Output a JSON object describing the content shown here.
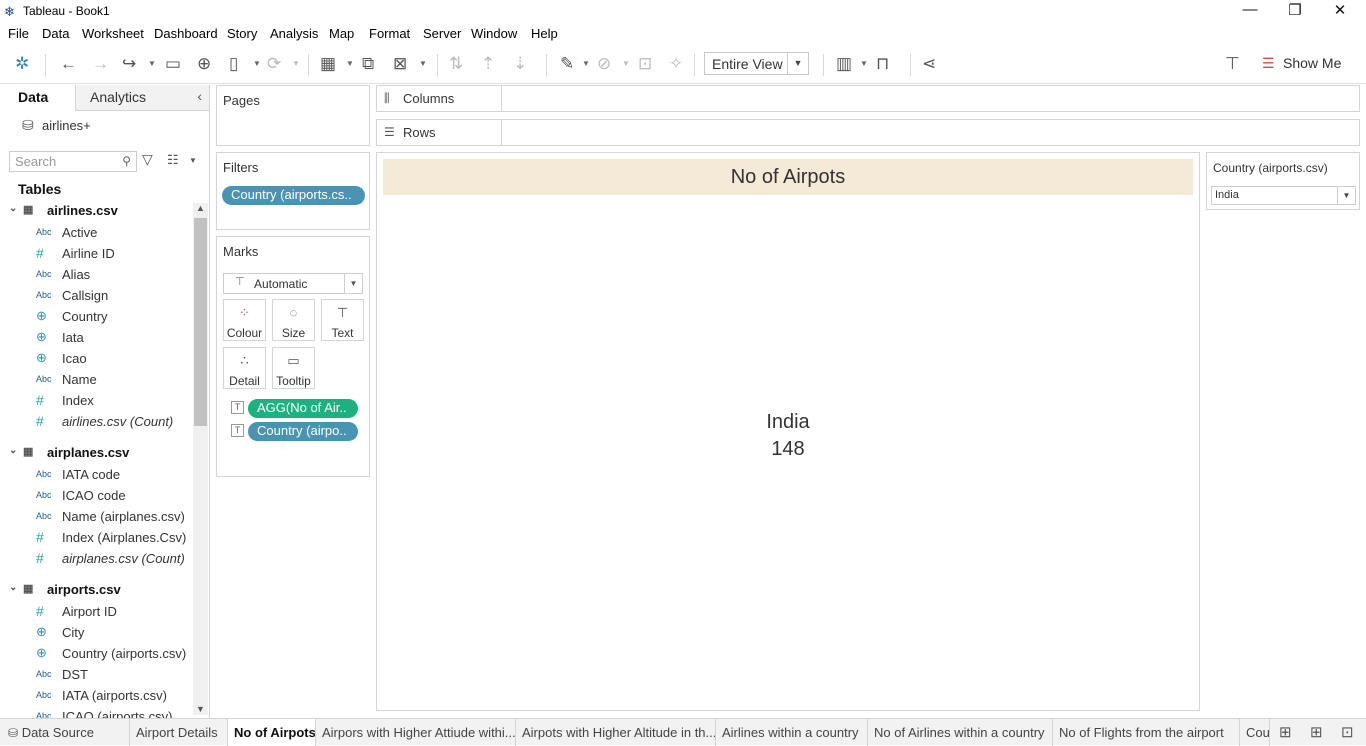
{
  "app": {
    "title": "Tableau - Book1"
  },
  "menu": [
    "File",
    "Data",
    "Worksheet",
    "Dashboard",
    "Story",
    "Analysis",
    "Map",
    "Format",
    "Server",
    "Window",
    "Help"
  ],
  "toolbar": {
    "fit": "Entire View",
    "show_me": "Show Me"
  },
  "left_pane": {
    "tab_data": "Data",
    "tab_analytics": "Analytics",
    "datasource": "airlines+",
    "search_placeholder": "Search",
    "tables_heading": "Tables",
    "tables": [
      {
        "name": "airlines.csv",
        "fields": [
          {
            "type": "Abc",
            "name": "Active"
          },
          {
            "type": "#",
            "name": "Airline ID"
          },
          {
            "type": "Abc",
            "name": "Alias"
          },
          {
            "type": "Abc",
            "name": "Callsign"
          },
          {
            "type": "globe",
            "name": "Country"
          },
          {
            "type": "globe",
            "name": "Iata"
          },
          {
            "type": "globe",
            "name": "Icao"
          },
          {
            "type": "Abc",
            "name": "Name"
          },
          {
            "type": "#",
            "name": "Index"
          },
          {
            "type": "#",
            "name": "airlines.csv (Count)"
          }
        ]
      },
      {
        "name": "airplanes.csv",
        "fields": [
          {
            "type": "Abc",
            "name": "IATA code"
          },
          {
            "type": "Abc",
            "name": "ICAO code"
          },
          {
            "type": "Abc",
            "name": "Name (airplanes.csv)"
          },
          {
            "type": "#",
            "name": "Index (Airplanes.Csv)"
          },
          {
            "type": "#",
            "name": "airplanes.csv (Count)"
          }
        ]
      },
      {
        "name": "airports.csv",
        "fields": [
          {
            "type": "#",
            "name": "Airport ID"
          },
          {
            "type": "globe",
            "name": "City"
          },
          {
            "type": "globe",
            "name": "Country (airports.csv)"
          },
          {
            "type": "Abc",
            "name": "DST"
          },
          {
            "type": "Abc",
            "name": "IATA (airports.csv)"
          },
          {
            "type": "Abc",
            "name": "ICAO (airports.csv)"
          }
        ]
      }
    ]
  },
  "pages": {
    "title": "Pages"
  },
  "filters": {
    "title": "Filters",
    "pill": "Country (airports.cs.."
  },
  "marks": {
    "title": "Marks",
    "type": "Automatic",
    "colour": "Colour",
    "size": "Size",
    "text": "Text",
    "detail": "Detail",
    "tooltip": "Tooltip",
    "pill1": "AGG(No of Air..",
    "pill2": "Country (airpo.."
  },
  "shelves": {
    "columns": "Columns",
    "rows": "Rows"
  },
  "viz": {
    "title": "No of Airpots",
    "country": "India",
    "value": "148"
  },
  "quick_filter": {
    "title": "Country (airports.csv)",
    "value": "India"
  },
  "sheets": {
    "datasource": "Data Source",
    "tabs": [
      "Airport Details",
      "No of Airpots",
      "Airpors with Higher Attiude withi...",
      "Airpots with Higher Altitude in th...",
      "Airlines within a country",
      "No of Airlines within a country",
      "No of  Flights from the airport",
      "Cou"
    ]
  },
  "colors": {
    "pill_blue": "#4b93b3",
    "pill_green": "#1db080",
    "title_band": "#f5e9d8"
  }
}
